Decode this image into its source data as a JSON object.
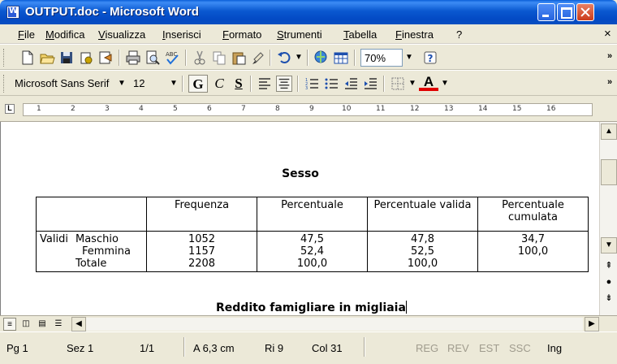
{
  "window": {
    "title": "OUTPUT.doc - Microsoft Word"
  },
  "menu": [
    "File",
    "Modifica",
    "Visualizza",
    "Inserisci",
    "Formato",
    "Strumenti",
    "Tabella",
    "Finestra",
    "?"
  ],
  "menu_close": "×",
  "toolbar_standard": {
    "zoom": "70%",
    "help": "?"
  },
  "toolbar_format": {
    "font": "Microsoft Sans Serif",
    "size": "12",
    "bold": "G",
    "italic": "C",
    "underline": "S",
    "font_color_letter": "A"
  },
  "ruler": {
    "marks": [
      "1",
      "2",
      "3",
      "4",
      "5",
      "6",
      "7",
      "8",
      "9",
      "10",
      "11",
      "12",
      "13",
      "14",
      "15",
      "16"
    ]
  },
  "document": {
    "heading1": "Sesso",
    "table": {
      "headers": [
        "",
        "Frequenza",
        "Percentuale",
        "Percentuale valida",
        "Percentuale cumulata"
      ],
      "group": "Validi",
      "rows": [
        {
          "label": "Maschio",
          "freq": "1052",
          "perc": "47,5",
          "valid": "47,8",
          "cum": "34,7"
        },
        {
          "label": "Femmina",
          "freq": "1157",
          "perc": "52,4",
          "valid": "52,5",
          "cum": "100,0"
        },
        {
          "label": "Totale",
          "freq": "2208",
          "perc": "100,0",
          "valid": "100,0",
          "cum": ""
        }
      ]
    },
    "heading2": "Reddito famigliare in migliaia"
  },
  "status": {
    "page": "Pg 1",
    "section": "Sez 1",
    "pages": "1/1",
    "at": "A 6,3 cm",
    "line": "Ri 9",
    "col": "Col 31",
    "reg": "REG",
    "rev": "REV",
    "est": "EST",
    "ssc": "SSC",
    "lang": "Ing"
  },
  "colors": {
    "titlebar": "#0a58d0",
    "chrome": "#ece9d8",
    "font_color": "#e00000"
  }
}
